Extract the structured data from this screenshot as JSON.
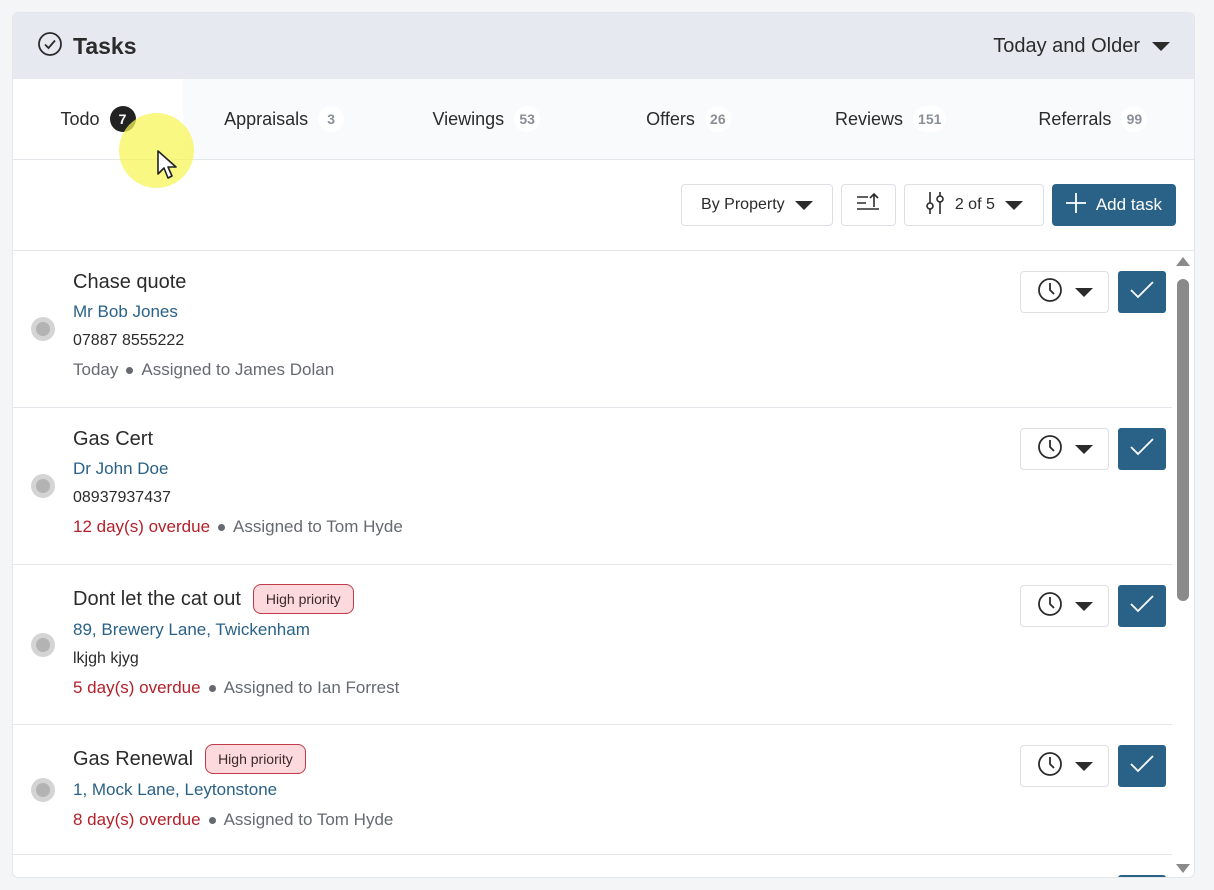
{
  "header": {
    "title": "Tasks",
    "range_label": "Today and Older"
  },
  "tabs": [
    {
      "label": "Todo",
      "count": "7"
    },
    {
      "label": "Appraisals",
      "count": "3"
    },
    {
      "label": "Viewings",
      "count": "53"
    },
    {
      "label": "Offers",
      "count": "26"
    },
    {
      "label": "Reviews",
      "count": "151"
    },
    {
      "label": "Referrals",
      "count": "99"
    }
  ],
  "toolbar": {
    "group_by": "By Property",
    "filter_count": "2 of 5",
    "add_label": "Add task"
  },
  "tasks": [
    {
      "title": "Chase quote",
      "badge": "",
      "link": "Mr Bob Jones",
      "phone": "07887 8555222",
      "due": "Today",
      "assigned": "Assigned to James Dolan"
    },
    {
      "title": "Gas Cert",
      "badge": "",
      "link": "Dr John Doe",
      "phone": "08937937437",
      "due": "12 day(s) overdue",
      "assigned": "Assigned to Tom Hyde"
    },
    {
      "title": "Dont let the cat out",
      "badge": "High priority",
      "link": "89, Brewery Lane, Twickenham",
      "phone": "lkjgh kjyg",
      "due": "5 day(s) overdue",
      "assigned": "Assigned to Ian Forrest"
    },
    {
      "title": "Gas Renewal",
      "badge": "High priority",
      "link": "1, Mock Lane, Leytonstone",
      "phone": "",
      "due": "8 day(s) overdue",
      "assigned": "Assigned to Tom Hyde"
    }
  ],
  "colors": {
    "accent": "#2a6187",
    "overdue": "#b3202a",
    "badge_bg": "#fbd9dc",
    "header_bg": "#e6eaf0"
  }
}
